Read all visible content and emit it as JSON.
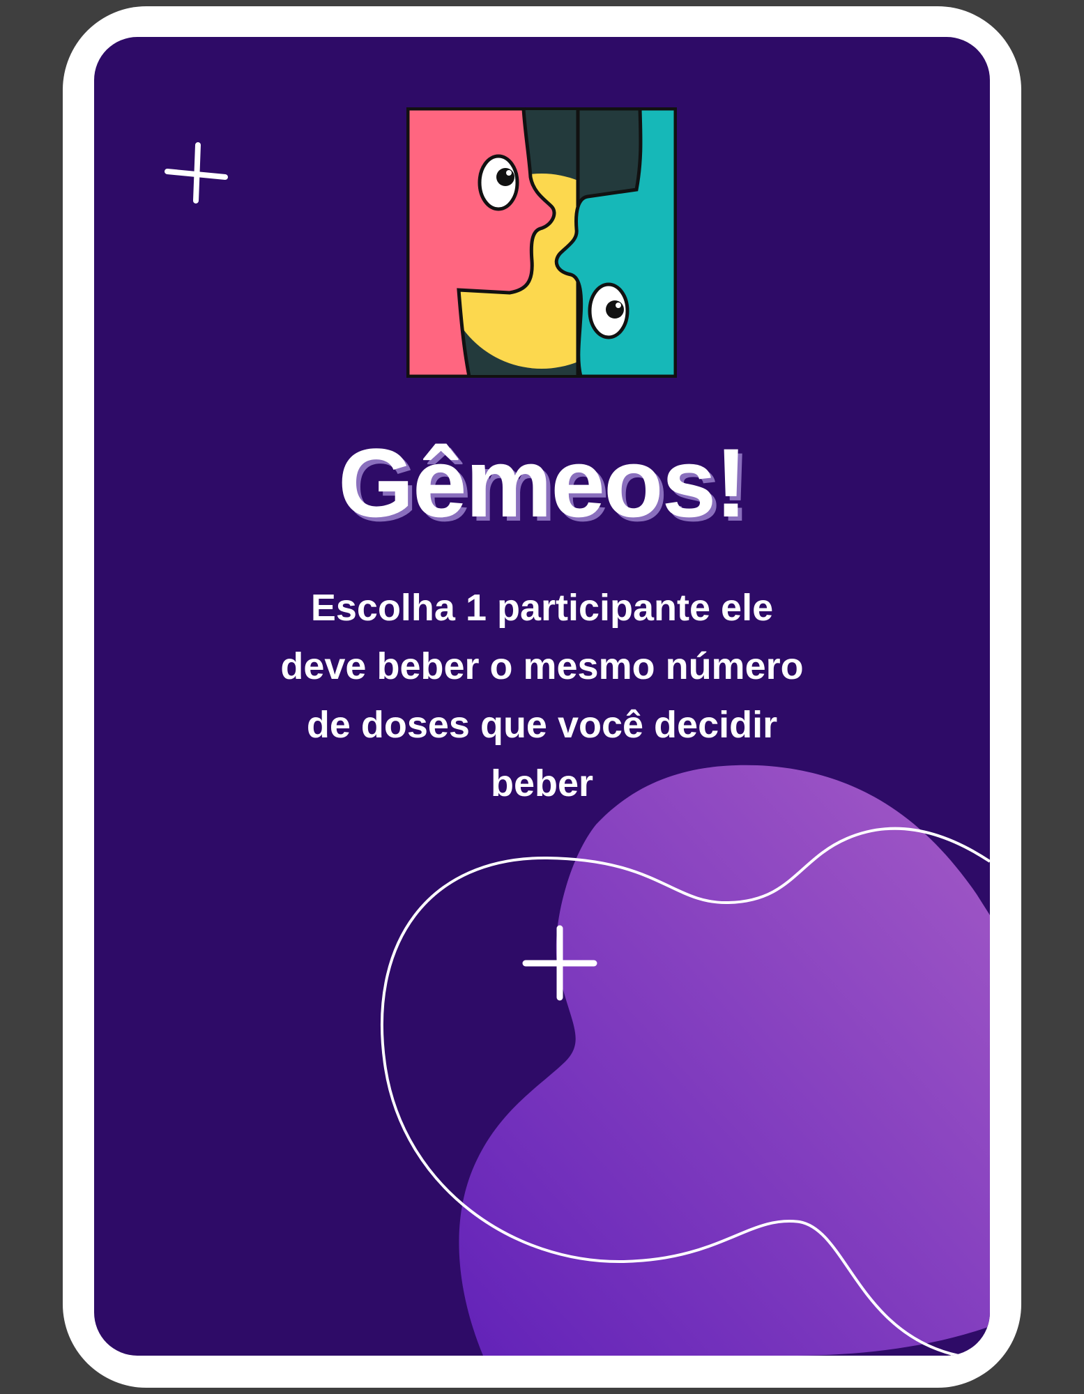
{
  "card": {
    "title": "Gêmeos!",
    "description": "Escolha 1 participante ele deve beber o mesmo número de doses que você decidir beber",
    "logo_icon": "twin-faces-icon",
    "decorations": [
      "sparkle-plus-icon",
      "sparkle-plus-icon",
      "purple-blob",
      "outline-ring"
    ]
  },
  "colors": {
    "page_background": "#3f3f3f",
    "card_border": "#ffffff",
    "card_background": "#2e0b67",
    "blob_gradient_start": "#6222b8",
    "blob_gradient_end": "#a35ac6",
    "title_shadow": "#8a6fbd",
    "face_pink": "#ff6680",
    "face_teal": "#16b8b8",
    "moon_yellow": "#fcd84e",
    "dark_green": "#233a3c"
  }
}
